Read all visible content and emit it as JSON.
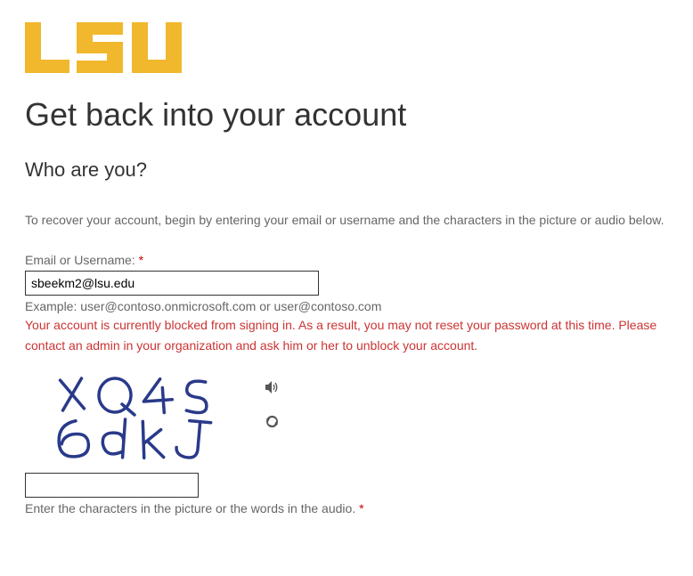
{
  "logo": {
    "text": "LSU",
    "color": "#f1b82d"
  },
  "heading": "Get back into your account",
  "subheading": "Who are you?",
  "instruction": "To recover your account, begin by entering your email or username and the characters in the picture or audio below.",
  "email": {
    "label": "Email or Username: ",
    "required": "*",
    "value": "sbeekm2@lsu.edu",
    "example": "Example: user@contoso.onmicrosoft.com or user@contoso.com"
  },
  "error": "Your account is currently blocked from signing in. As a result, you may not reset your password at this time. Please contact an admin in your organization and ask him or her to unblock your account.",
  "captcha": {
    "displayed_text": "XQ4S 6dkJ",
    "hint": "Enter the characters in the picture or the words in the audio. ",
    "required": "*"
  },
  "icons": {
    "audio": "audio-icon",
    "refresh": "refresh-icon"
  }
}
